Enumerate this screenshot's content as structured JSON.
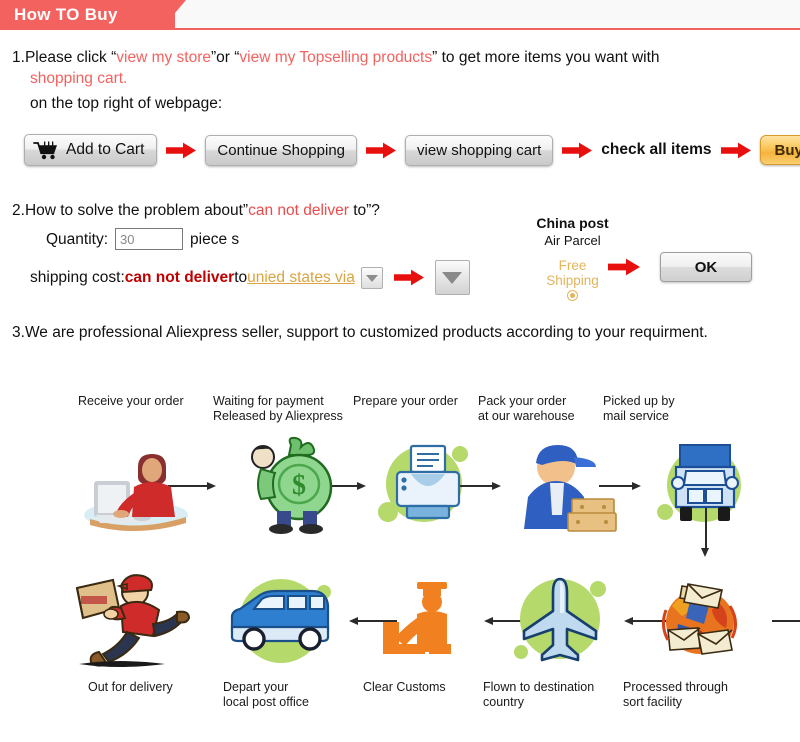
{
  "header": {
    "title": "How TO Buy",
    "accent_color": "#f4625f"
  },
  "section1": {
    "number": "1.",
    "line1_a": "Please click “",
    "link1": "view my store",
    "line1_b": "”or “",
    "link2": "view my Topselling products",
    "line1_c": "” to get more items you want with",
    "line2": "shopping cart.",
    "line3": "on the top right of webpage:",
    "buttons": {
      "add_to_cart": "Add to Cart",
      "continue_shopping": "Continue Shopping",
      "view_shopping_cart": "view shopping cart",
      "check_all_items": "check all items",
      "buy_now": "Buy now"
    },
    "cart_icon": "shopping-cart-icon",
    "arrow_icon": "red-right-arrow-icon"
  },
  "section2": {
    "number": "2.",
    "line1_a": "How to solve the problem about”",
    "line1_red": "can not deliver",
    "line1_b": " to”?",
    "quantity_label": "Quantity:",
    "quantity_value": "30",
    "quantity_unit": "piece s",
    "shipping_label": "shipping cost:",
    "shipping_red": "can not deliver",
    "shipping_to": " to ",
    "shipping_country": "unied states via",
    "china_post_title": "China post",
    "china_post_sub": "Air Parcel",
    "free_shipping_l1": "Free",
    "free_shipping_l2": "Shipping",
    "ok_button": "OK",
    "dropdown_small_icon": "chevron-down-icon",
    "dropdown_large_icon": "chevron-down-icon",
    "arrow_icon": "red-right-arrow-icon"
  },
  "section3": {
    "number": "3.",
    "text": "We are professional Aliexpress seller, support to customized products according to your requirment."
  },
  "flow": {
    "top_steps": [
      {
        "label": "Receive your order",
        "icon": "person-at-computer-icon"
      },
      {
        "label": "Waiting for payment\nReleased by Aliexpress",
        "icon": "money-bag-person-icon"
      },
      {
        "label": "Prepare your order",
        "icon": "printer-icon"
      },
      {
        "label": "Pack your order\nat our warehouse",
        "icon": "warehouse-worker-boxes-icon"
      },
      {
        "label": "Picked up by\nmail service",
        "icon": "delivery-truck-icon"
      }
    ],
    "bottom_steps": [
      {
        "label": "Out for delivery",
        "icon": "running-courier-icon"
      },
      {
        "label": "Depart your\nlocal post office",
        "icon": "delivery-van-icon"
      },
      {
        "label": "Clear Customs",
        "icon": "customs-officer-icon"
      },
      {
        "label": "Flown to destination\ncountry",
        "icon": "airplane-icon"
      },
      {
        "label": "Processed through\nsort facility",
        "icon": "mail-sorting-icon"
      }
    ],
    "blob_color": "#b5da6b",
    "connector_color": "#2b2b2b"
  }
}
